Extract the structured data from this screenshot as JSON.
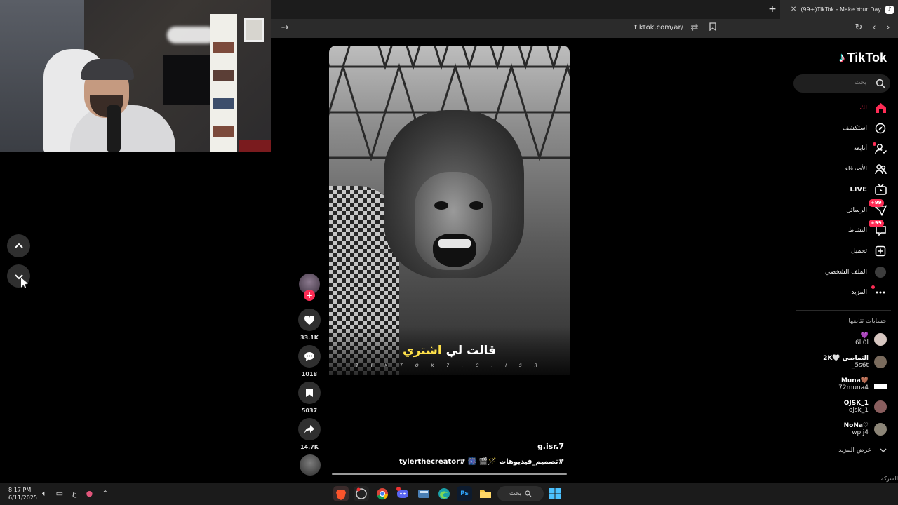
{
  "browser": {
    "tab_title": "(99+)TikTok - Make Your Day",
    "url": "tiktok.com/ar/"
  },
  "feed": {
    "video": {
      "caption_plain": "قالت لي ",
      "caption_highlight": "اشتري",
      "watermark": "T I K T O K 7 . G . I S R",
      "username": "g.isr.7",
      "description": "#تصميم_فيديوهات 🪄🎬 🎆 #tylerthecreator"
    },
    "actions": {
      "likes": "33.1K",
      "comments": "1018",
      "saves": "5037",
      "shares": "14.7K"
    }
  },
  "sidebar": {
    "brand": "TikTok",
    "search_placeholder": "بحث",
    "nav": [
      {
        "label": "لك",
        "icon": "home-icon",
        "active": true
      },
      {
        "label": "استكشف",
        "icon": "compass-icon"
      },
      {
        "label": "أتابعه",
        "icon": "following-icon"
      },
      {
        "label": "الأصدقاء",
        "icon": "friends-icon"
      },
      {
        "label": "LIVE",
        "icon": "live-icon"
      },
      {
        "label": "الرسائل",
        "icon": "messages-icon",
        "badge": "+99"
      },
      {
        "label": "النشاط",
        "icon": "activity-icon",
        "badge": "+99"
      },
      {
        "label": "تحميل",
        "icon": "upload-icon"
      },
      {
        "label": "الملف الشخصي",
        "icon": "profile-avatar"
      },
      {
        "label": "المزيد",
        "icon": "more-icon"
      }
    ],
    "following_title": "حسابات تتابعها",
    "accounts": [
      {
        "name": "💜",
        "handle": "6li0l"
      },
      {
        "name": "2K🤍 التماصي",
        "handle": "_5s6t"
      },
      {
        "name": "Muna🤎",
        "handle": "72muna4"
      },
      {
        "name": "OJSK_1",
        "handle": "ojsk_1"
      },
      {
        "name": "NoNa♡",
        "handle": "wpij4"
      }
    ],
    "see_more": "عرض المزيد",
    "corner_text": "الشركة"
  },
  "taskbar": {
    "time": "8:17 PM",
    "date": "6/11/2025",
    "lang": "ع",
    "search_label": "بحث"
  },
  "colors": {
    "accent": "#fe2c55",
    "background": "#000000"
  }
}
